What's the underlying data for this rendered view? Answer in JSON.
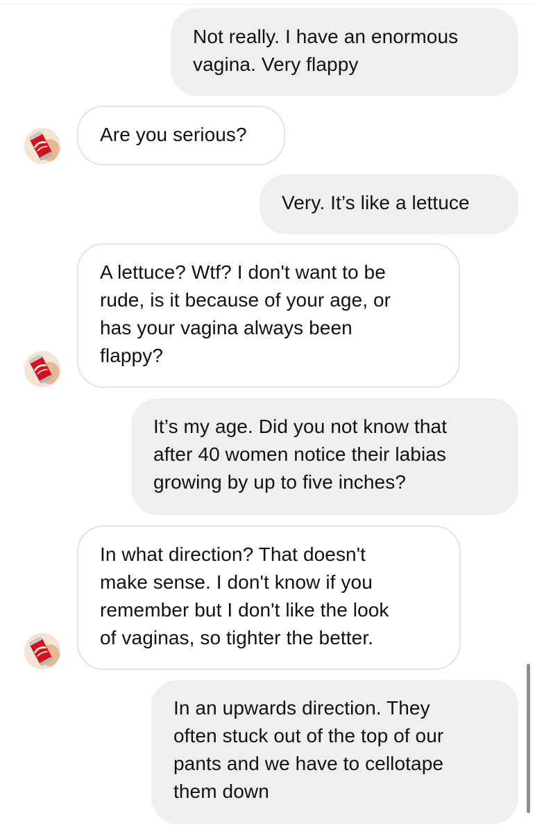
{
  "conversation": {
    "messages": [
      {
        "side": "sent",
        "text": "Not really. I have an enormous\nvagina. Very flappy"
      },
      {
        "side": "received",
        "text": "Are you serious?",
        "avatar": "coca-cola-can-avatar"
      },
      {
        "side": "sent",
        "text": "Very. It’s like a lettuce"
      },
      {
        "side": "received",
        "text": "A lettuce? Wtf? I don't want to be\nrude, is it because of your age, or\nhas your vagina always been\nflappy?",
        "avatar": "coca-cola-can-avatar"
      },
      {
        "side": "sent",
        "text": "It’s my age. Did you not know that\nafter 40 women notice their labias\ngrowing by up to five inches?"
      },
      {
        "side": "received",
        "text": "In what direction? That doesn't\nmake sense. I don't know if you\nremember but I don't like the look\nof vaginas, so tighter the better.",
        "avatar": "coca-cola-can-avatar"
      },
      {
        "side": "sent",
        "text": "In an upwards direction. They\noften stuck out of the top of our\npants and we have to cellotape\nthem down"
      }
    ]
  },
  "colors": {
    "sent_bubble": "#efefef",
    "received_bubble_border": "#e3e3e3",
    "text": "#111111",
    "avatar_can_red": "#d5121c"
  }
}
